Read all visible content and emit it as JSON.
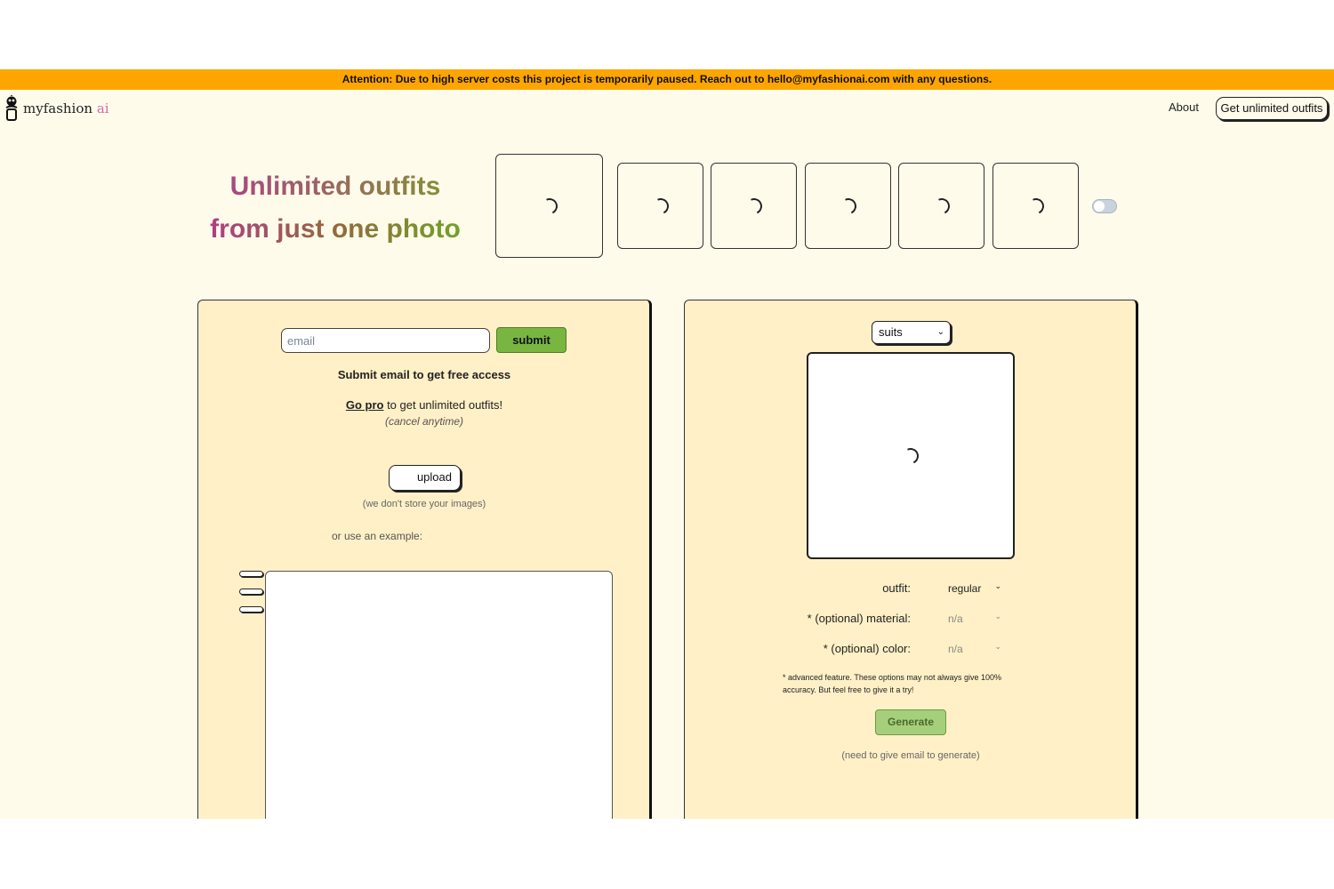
{
  "banner": {
    "text": "Attention: Due to high server costs this project is temporarily paused. Reach out to hello@myfashionai.com with any questions."
  },
  "header": {
    "logo_name": "myfashion",
    "logo_suffix": "ai",
    "about_label": "About",
    "cta_label": "Get unlimited outfits"
  },
  "hero": {
    "line1": "Unlimited outfits",
    "line2": "from just one photo"
  },
  "left_panel": {
    "email_placeholder": "email",
    "submit_label": "submit",
    "submit_note": "Submit email to get free access",
    "gopro_link": "Go pro",
    "gopro_rest": " to get unlimited outfits!",
    "cancel_note": "(cancel anytime)",
    "upload_label": "upload",
    "store_note": "(we don't store your images)",
    "example_label": "or use an example:"
  },
  "right_panel": {
    "category_value": "suits",
    "options": [
      {
        "label": "outfit:",
        "value": "regular"
      },
      {
        "label": "* (optional) material:",
        "value": "n/a"
      },
      {
        "label": "* (optional) color:",
        "value": "n/a"
      }
    ],
    "advanced_note": "* advanced feature. These options may not always give 100% accuracy. But feel free to give it a try!",
    "generate_label": "Generate",
    "generate_note": "(need to give email to generate)"
  },
  "icons": {
    "logo": "robot-hanger-icon",
    "loading": "spinner-icon",
    "dropdown": "chevron-down-icon",
    "toggle": "toggle-switch"
  },
  "colors": {
    "banner": "#ffa500",
    "page_bg": "#fffbeb",
    "panel_bg": "#fff0c7",
    "submit": "#79b641",
    "generate": "#a6cf7c",
    "title_pink": "#b03b8c",
    "title_green": "#6ea82a"
  }
}
